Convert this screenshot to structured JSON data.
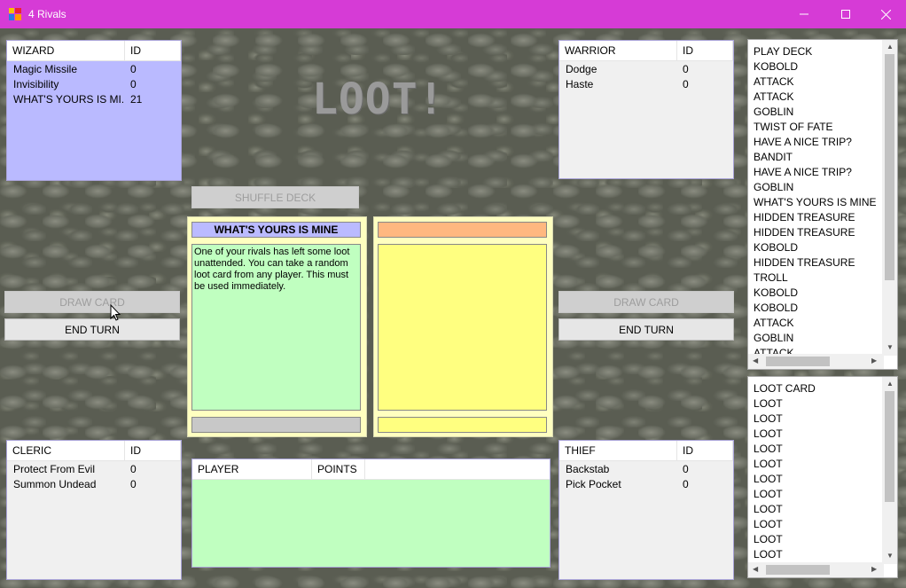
{
  "window": {
    "title": "4 Rivals"
  },
  "loot_banner": "LOOT!",
  "wizard": {
    "header": "WIZARD",
    "id_header": "ID",
    "rows": [
      {
        "name": "Magic Missile",
        "id": "0"
      },
      {
        "name": "Invisibility",
        "id": "0"
      },
      {
        "name": "WHAT'S YOURS IS MI...",
        "id": "21"
      }
    ]
  },
  "warrior": {
    "header": "WARRIOR",
    "id_header": "ID",
    "rows": [
      {
        "name": "Dodge",
        "id": "0"
      },
      {
        "name": "Haste",
        "id": "0"
      }
    ]
  },
  "cleric": {
    "header": "CLERIC",
    "id_header": "ID",
    "rows": [
      {
        "name": "Protect From Evil",
        "id": "0"
      },
      {
        "name": "Summon Undead",
        "id": "0"
      }
    ]
  },
  "thief": {
    "header": "THIEF",
    "id_header": "ID",
    "rows": [
      {
        "name": "Backstab",
        "id": "0"
      },
      {
        "name": "Pick Pocket",
        "id": "0"
      }
    ]
  },
  "buttons": {
    "shuffle": "SHUFFLE DECK",
    "draw_left": "DRAW CARD",
    "end_left": "END TURN",
    "draw_right": "DRAW CARD",
    "end_right": "END TURN"
  },
  "card": {
    "title": "WHAT'S YOURS IS MINE",
    "text": "One of your rivals has left some loot unattended. You can take a random loot card from any player. This must be used immediately."
  },
  "score": {
    "player_header": "PLAYER",
    "points_header": "POINTS"
  },
  "play_deck": {
    "items": [
      "PLAY DECK",
      "KOBOLD",
      "ATTACK",
      "ATTACK",
      "GOBLIN",
      "TWIST OF FATE",
      "HAVE A NICE TRIP?",
      "BANDIT",
      "HAVE A NICE TRIP?",
      "GOBLIN",
      "WHAT'S YOURS IS MINE",
      "HIDDEN TREASURE",
      "HIDDEN TREASURE",
      "KOBOLD",
      "HIDDEN TREASURE",
      "TROLL",
      "KOBOLD",
      "KOBOLD",
      "ATTACK",
      "GOBLIN",
      "ATTACK"
    ]
  },
  "loot_deck": {
    "items": [
      "LOOT CARD",
      "LOOT",
      "LOOT",
      "LOOT",
      "LOOT",
      "LOOT",
      "LOOT",
      "LOOT",
      "LOOT",
      "LOOT",
      "LOOT",
      "LOOT"
    ]
  },
  "colors": {
    "titlebar": "#d63bd6",
    "wizard_bg": "#babaff",
    "card_title_bg": "#babaff",
    "card_body_bg": "#c0ffc0",
    "right_card_bg": "#ffff80",
    "right_card_header": "#ffb880",
    "card_frame": "#ffffc0",
    "score_bg": "#c0ffc0"
  }
}
